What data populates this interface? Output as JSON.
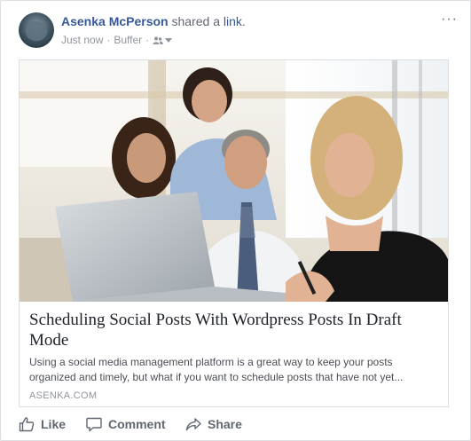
{
  "post": {
    "author": "Asenka McPerson",
    "verb": "shared a",
    "link_word": "link",
    "period": ".",
    "timestamp": "Just now",
    "separator": "·",
    "app": "Buffer",
    "audience_icon": "friends-icon",
    "more_icon": "more-options-icon",
    "more_label": "···"
  },
  "link_preview": {
    "image_alt": "Four colleagues gathered around a laptop in an office",
    "title": "Scheduling Social Posts With Wordpress Posts In Draft Mode",
    "description": "Using a social media management platform is a great way to keep your posts organized and timely, but what if you want to schedule posts that have not yet...",
    "domain": "ASENKA.COM"
  },
  "actions": {
    "like": "Like",
    "comment": "Comment",
    "share": "Share"
  },
  "colors": {
    "name_link": "#365899",
    "muted": "#90949c",
    "action_text": "#606770",
    "card_border": "#dddfe2"
  }
}
